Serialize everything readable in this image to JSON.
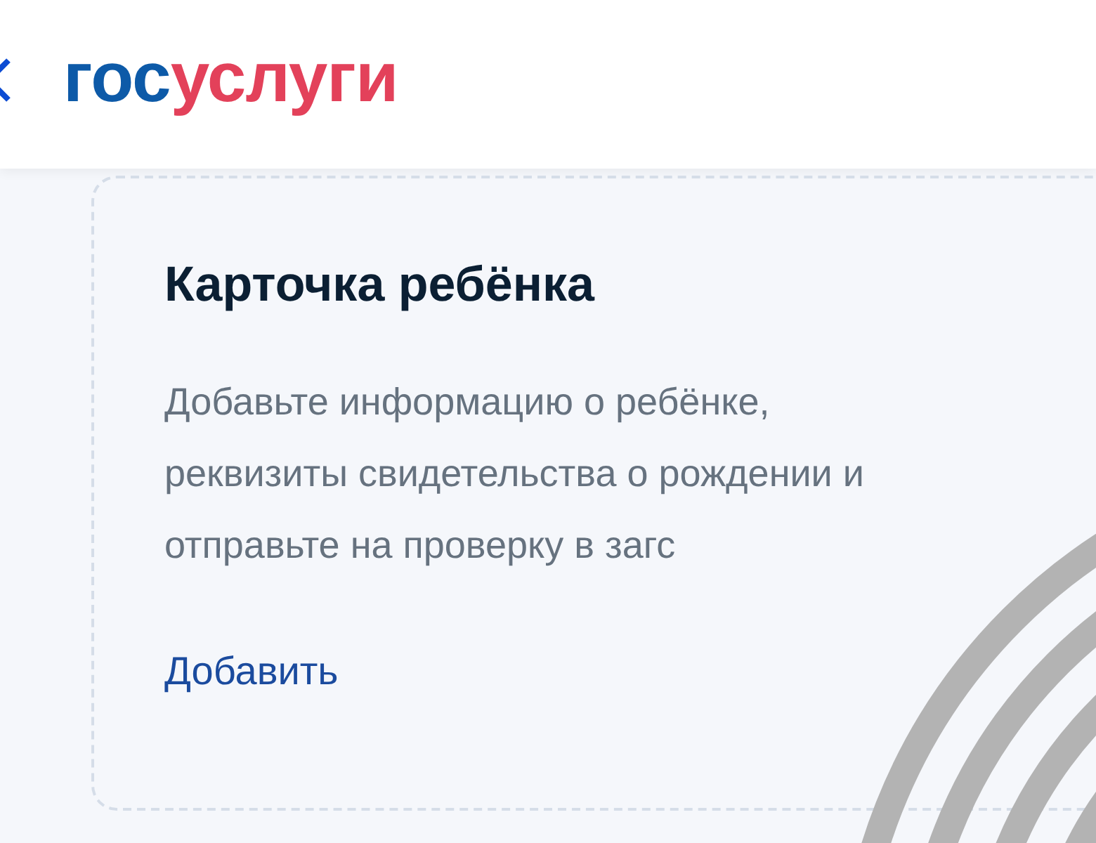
{
  "header": {
    "logo": [
      "гос",
      "услуги"
    ]
  },
  "card": {
    "title": "Карточка ребёнка",
    "description": [
      "Добавьте информацию о ребёнке,",
      "реквизиты свидетельства о рождении и",
      "отправьте на проверку в загс"
    ],
    "link": "Добавить"
  }
}
